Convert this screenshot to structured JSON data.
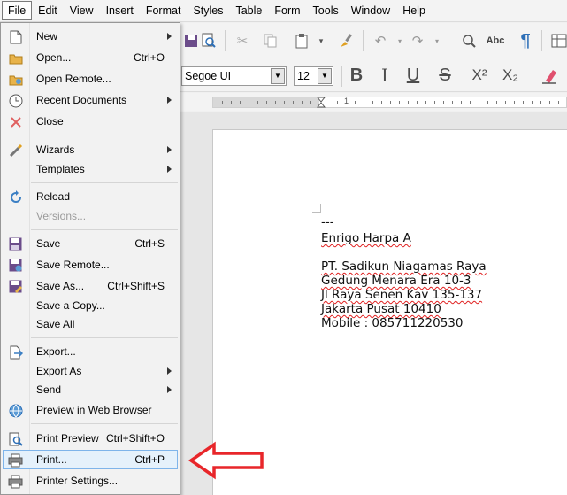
{
  "menubar": {
    "items": [
      "File",
      "Edit",
      "View",
      "Insert",
      "Format",
      "Styles",
      "Table",
      "Form",
      "Tools",
      "Window",
      "Help"
    ],
    "active": "File"
  },
  "toolbar": {
    "font_name": "Segoe UI",
    "font_size": "12",
    "bold_icon": "B",
    "italic_icon": "I",
    "underline_icon": "U",
    "strike_icon": "S",
    "superscript_icon": "X²",
    "subscript_icon": "X₂",
    "abc_icon": "Abc",
    "pilcrow_icon": "¶"
  },
  "ruler": {
    "numbers": [
      "1"
    ]
  },
  "file_menu": {
    "items": [
      {
        "label": "New",
        "shortcut": "",
        "submenu": true,
        "disabled": false,
        "icon": "new-document-icon"
      },
      {
        "label": "Open...",
        "shortcut": "Ctrl+O",
        "submenu": false,
        "disabled": false,
        "icon": "open-folder-icon"
      },
      {
        "label": "Open Remote...",
        "shortcut": "",
        "submenu": false,
        "disabled": false,
        "icon": "open-remote-folder-icon"
      },
      {
        "label": "Recent Documents",
        "shortcut": "",
        "submenu": true,
        "disabled": false,
        "icon": "clock-icon"
      },
      {
        "label": "Close",
        "shortcut": "",
        "submenu": false,
        "disabled": false,
        "icon": "close-icon"
      },
      {
        "label": "Wizards",
        "shortcut": "",
        "submenu": true,
        "disabled": false,
        "icon": "wizard-wand-icon"
      },
      {
        "label": "Templates",
        "shortcut": "",
        "submenu": true,
        "disabled": false,
        "icon": ""
      },
      {
        "label": "Reload",
        "shortcut": "",
        "submenu": false,
        "disabled": false,
        "icon": "reload-icon"
      },
      {
        "label": "Versions...",
        "shortcut": "",
        "submenu": false,
        "disabled": true,
        "icon": ""
      },
      {
        "label": "Save",
        "shortcut": "Ctrl+S",
        "submenu": false,
        "disabled": false,
        "icon": "save-icon"
      },
      {
        "label": "Save Remote...",
        "shortcut": "",
        "submenu": false,
        "disabled": false,
        "icon": "save-remote-icon"
      },
      {
        "label": "Save As...",
        "shortcut": "Ctrl+Shift+S",
        "submenu": false,
        "disabled": false,
        "icon": "save-as-icon"
      },
      {
        "label": "Save a Copy...",
        "shortcut": "",
        "submenu": false,
        "disabled": false,
        "icon": ""
      },
      {
        "label": "Save All",
        "shortcut": "",
        "submenu": false,
        "disabled": false,
        "icon": ""
      },
      {
        "label": "Export...",
        "shortcut": "",
        "submenu": false,
        "disabled": false,
        "icon": "export-icon"
      },
      {
        "label": "Export As",
        "shortcut": "",
        "submenu": true,
        "disabled": false,
        "icon": ""
      },
      {
        "label": "Send",
        "shortcut": "",
        "submenu": true,
        "disabled": false,
        "icon": ""
      },
      {
        "label": "Preview in Web Browser",
        "shortcut": "",
        "submenu": false,
        "disabled": false,
        "icon": "globe-icon"
      },
      {
        "label": "Print Preview",
        "shortcut": "Ctrl+Shift+O",
        "submenu": false,
        "disabled": false,
        "icon": "print-preview-icon"
      },
      {
        "label": "Print...",
        "shortcut": "Ctrl+P",
        "submenu": false,
        "disabled": false,
        "icon": "printer-icon",
        "highlighted": true
      },
      {
        "label": "Printer Settings...",
        "shortcut": "",
        "submenu": false,
        "disabled": false,
        "icon": "printer-settings-icon"
      }
    ]
  },
  "document": {
    "lines": [
      "---",
      "Enrigo Harpa A",
      "",
      "PT. Sadikun Niagamas Raya",
      "Gedung Menara Era 10-3",
      "Jl Raya Senen Kav 135-137",
      "Jakarta Pusat 10410",
      "Mobile : 085711220530"
    ]
  },
  "colors": {
    "accent_highlight": "#e5f1fb",
    "highlight_border": "#7eb4ea",
    "annotation_arrow": "#e8262a",
    "spellcheck_underline": "#e02020"
  }
}
